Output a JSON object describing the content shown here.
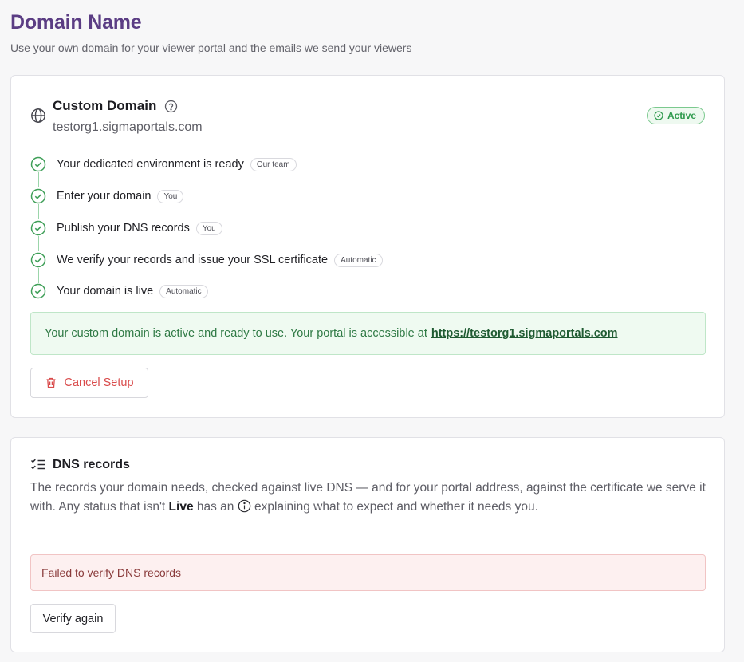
{
  "page": {
    "title": "Domain Name",
    "subtitle": "Use your own domain for your viewer portal and the emails we send your viewers"
  },
  "custom_domain": {
    "title": "Custom Domain",
    "domain": "testorg1.sigmaportals.com",
    "status_badge": "Active",
    "steps": [
      {
        "label": "Your dedicated environment is ready",
        "tag": "Our team",
        "done": true
      },
      {
        "label": "Enter your domain",
        "tag": "You",
        "done": true
      },
      {
        "label": "Publish your DNS records",
        "tag": "You",
        "done": true
      },
      {
        "label": "We verify your records and issue your SSL certificate",
        "tag": "Automatic",
        "done": true
      },
      {
        "label": "Your domain is live",
        "tag": "Automatic",
        "done": true
      }
    ],
    "success_message": "Your custom domain is active and ready to use. Your portal is accessible at",
    "portal_link": "https://testorg1.sigmaportals.com",
    "cancel_button": "Cancel Setup"
  },
  "dns_records": {
    "title": "DNS records",
    "desc_part1": "The records your domain needs, checked against live DNS — and for your portal address, against the certificate we serve it with. Any status that isn't ",
    "desc_bold": "Live",
    "desc_part2": " has an ",
    "desc_part3": " explaining what to expect and whether it needs you.",
    "error_message": "Failed to verify DNS records",
    "verify_button": "Verify again"
  },
  "colors": {
    "title_purple": "#5b3d84",
    "success_green": "#2f9a4d",
    "danger_red": "#d94b4b"
  },
  "icons": {
    "globe": "globe-icon",
    "help": "help-circle-icon",
    "active": "check-circle-icon",
    "step": "check-circle-icon",
    "cancel": "trash-icon",
    "dns": "checklist-icon",
    "info": "info-circle-icon"
  }
}
